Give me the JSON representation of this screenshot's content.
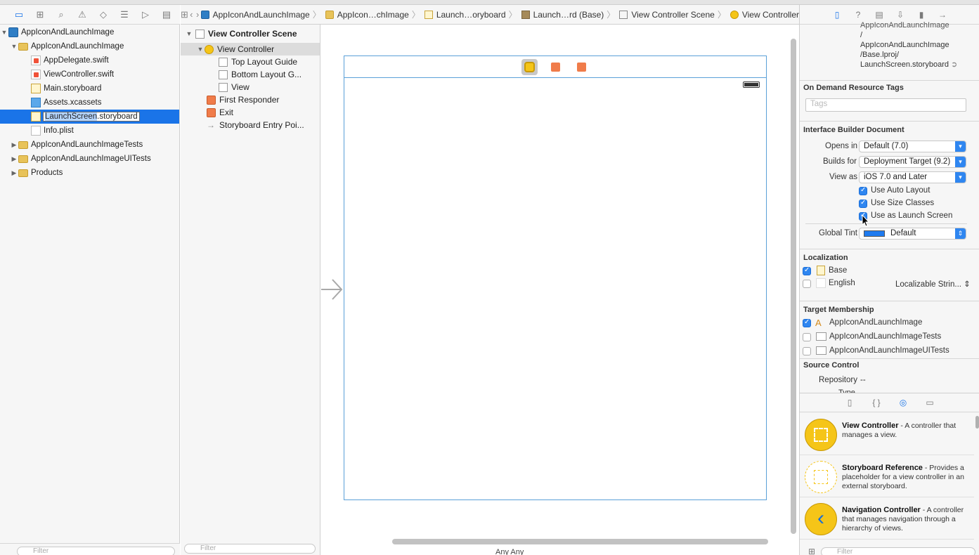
{
  "navigator": {
    "tabs": [
      "folder-icon",
      "symbol-icon",
      "search-icon",
      "warning-icon",
      "test-icon",
      "debug-icon",
      "breakpoint-icon",
      "report-icon"
    ],
    "tree": [
      {
        "label": "AppIconAndLaunchImage",
        "type": "project"
      },
      {
        "label": "AppIconAndLaunchImage",
        "type": "folder"
      },
      {
        "label": "AppDelegate.swift",
        "type": "swift"
      },
      {
        "label": "ViewController.swift",
        "type": "swift"
      },
      {
        "label": "Main.storyboard",
        "type": "storyboard"
      },
      {
        "label": "Assets.xcassets",
        "type": "assets"
      },
      {
        "label": "LaunchScreen.storyboard",
        "label_name": "LaunchScreen",
        "label_ext": ".storyboard",
        "type": "storyboard"
      },
      {
        "label": "Info.plist",
        "type": "plist"
      },
      {
        "label": "AppIconAndLaunchImageTests",
        "type": "folder"
      },
      {
        "label": "AppIconAndLaunchImageUITests",
        "type": "folder"
      },
      {
        "label": "Products",
        "type": "folder"
      }
    ],
    "filter_placeholder": "Filter"
  },
  "jumpbar": {
    "crumbs": [
      "AppIconAndLaunchImage",
      "AppIcon…chImage",
      "Launch…oryboard",
      "Launch…rd (Base)",
      "View Controller Scene",
      "View Controller"
    ]
  },
  "outline": {
    "rows": [
      "View Controller Scene",
      "View Controller",
      "Top Layout Guide",
      "Bottom Layout G...",
      "View",
      "First Responder",
      "Exit",
      "Storyboard Entry Poi..."
    ],
    "filter_placeholder": "Filter"
  },
  "canvas": {
    "size_class": "Any  Any"
  },
  "inspector": {
    "tabs": [
      "file-icon",
      "help-icon",
      "identity-icon",
      "attributes-icon",
      "size-icon",
      "connections-icon"
    ],
    "path_lines": [
      "AppIconAndLaunchImage",
      "/",
      "AppIconAndLaunchImage",
      "/Base.lproj/",
      "LaunchScreen.storyboard"
    ],
    "on_demand_title": "On Demand Resource Tags",
    "tags_placeholder": "Tags",
    "ib_doc_title": "Interface Builder Document",
    "opens_in_label": "Opens in",
    "opens_in_value": "Default (7.0)",
    "builds_for_label": "Builds for",
    "builds_for_value": "Deployment Target (9.2)",
    "view_as_label": "View as",
    "view_as_value": "iOS 7.0 and Later",
    "checks": [
      {
        "label": "Use Auto Layout",
        "checked": true
      },
      {
        "label": "Use Size Classes",
        "checked": true
      },
      {
        "label": "Use as Launch Screen",
        "checked": true
      }
    ],
    "global_tint_label": "Global Tint",
    "global_tint_value": "Default",
    "tint_color": "#1f7bf0",
    "localization_title": "Localization",
    "localizations": [
      {
        "label": "Base",
        "checked": true,
        "value": ""
      },
      {
        "label": "English",
        "checked": false,
        "value": "Localizable Strin..."
      }
    ],
    "target_title": "Target Membership",
    "targets": [
      {
        "label": "AppIconAndLaunchImage",
        "checked": true
      },
      {
        "label": "AppIconAndLaunchImageTests",
        "checked": false
      },
      {
        "label": "AppIconAndLaunchImageUITests",
        "checked": false
      }
    ],
    "source_control_title": "Source Control",
    "repository_label": "Repository",
    "repository_value": "--",
    "type_label": "Type"
  },
  "library": {
    "tabs": [
      "file-template-icon",
      "code-snippet-icon",
      "object-library-icon",
      "media-library-icon"
    ],
    "items": [
      {
        "title": "View Controller",
        "desc": " - A controller that manages a view."
      },
      {
        "title": "Storyboard Reference",
        "desc": " - Provides a placeholder for a view controller in an external storyboard."
      },
      {
        "title": "Navigation Controller",
        "desc": " - A controller that manages navigation through a hierarchy of views."
      }
    ],
    "filter_placeholder": "Filter"
  }
}
